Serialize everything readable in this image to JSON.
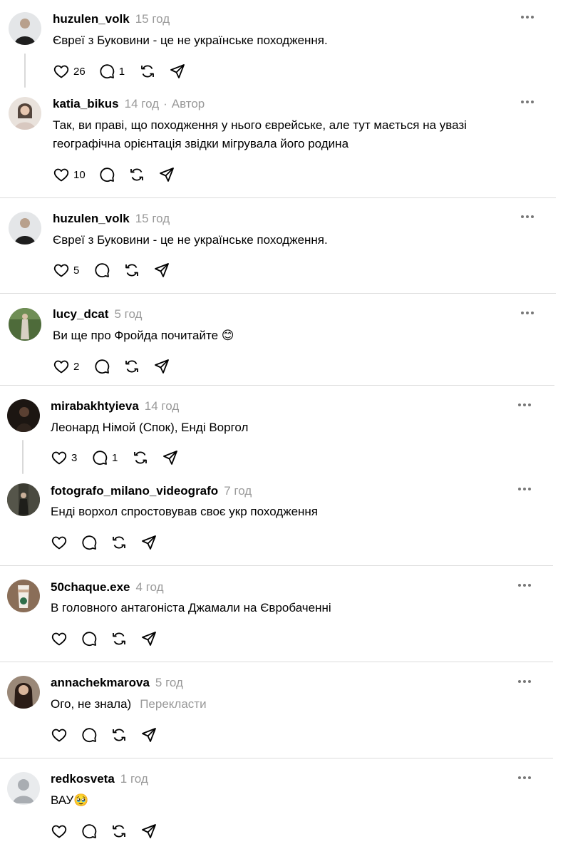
{
  "posts": [
    {
      "username": "huzulen_volk",
      "time": "15 год",
      "author": "",
      "text": "Євреї з Буковини - це не українське походження.",
      "text2": "",
      "translate": "",
      "likes": "26",
      "replies": "1",
      "avatar_color": "#8a8a8a"
    },
    {
      "username": "katia_bikus",
      "time": "14 год",
      "author": "Автор",
      "text": "Так, ви праві, що походження у нього єврейське, але тут мається на увазі",
      "text2": "географічна орієнтація звідки мігрувала його родина",
      "translate": "",
      "likes": "10",
      "replies": "",
      "avatar_color": "#a07a6a"
    },
    {
      "username": "huzulen_volk",
      "time": "15 год",
      "author": "",
      "text": "Євреї з Буковини - це не українське походження.",
      "text2": "",
      "translate": "",
      "likes": "5",
      "replies": "",
      "avatar_color": "#8a8a8a"
    },
    {
      "username": "lucy_dcat",
      "time": "5 год",
      "author": "",
      "text": "Ви ще про Фройда почитайте 😊",
      "text2": "",
      "translate": "",
      "likes": "2",
      "replies": "",
      "avatar_color": "#4e6b3a"
    },
    {
      "username": "mirabakhtyieva",
      "time": "14 год",
      "author": "",
      "text": "Леонард Німой (Спок), Енді Воргол",
      "text2": "",
      "translate": "",
      "likes": "3",
      "replies": "1",
      "avatar_color": "#2a1f1a"
    },
    {
      "username": "fotografo_milano_videografo",
      "time": "7 год",
      "author": "",
      "text": "Енді ворхол спростовував своє укр походження",
      "text2": "",
      "translate": "",
      "likes": "",
      "replies": "",
      "avatar_color": "#3b3b32"
    },
    {
      "username": "50chaque.exe",
      "time": "4 год",
      "author": "",
      "text": "В головного антагоніста Джамали на Євробаченні",
      "text2": "",
      "translate": "",
      "likes": "",
      "replies": "",
      "avatar_color": "#6b5040"
    },
    {
      "username": "annachekmarova",
      "time": "5 год",
      "author": "",
      "text": "Ого, не знала)",
      "text2": "",
      "translate": "Перекласти",
      "likes": "",
      "replies": "",
      "avatar_color": "#3a2a22"
    },
    {
      "username": "redkosveta",
      "time": "1 год",
      "author": "",
      "text": "ВАУ🥹",
      "text2": "",
      "translate": "",
      "likes": "",
      "replies": "",
      "avatar_color": "#cfd3d7"
    }
  ],
  "icons": {
    "like": "heart-icon",
    "reply": "comment-icon",
    "repost": "repost-icon",
    "share": "send-icon",
    "more": "more-icon"
  }
}
